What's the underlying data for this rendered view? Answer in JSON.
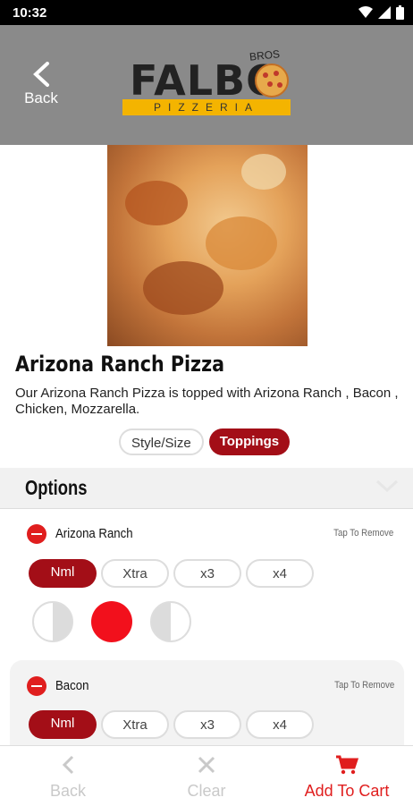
{
  "status_bar": {
    "time": "10:32"
  },
  "header": {
    "back_label": "Back",
    "logo": {
      "brand": "FALBO",
      "tag": "BROS",
      "banner": "PIZZERIA"
    }
  },
  "product": {
    "name": "Arizona Ranch Pizza",
    "description": "Our Arizona Ranch Pizza is topped with Arizona Ranch , Bacon , Chicken, Mozzarella."
  },
  "tabs": [
    {
      "label": "Style/Size",
      "active": false
    },
    {
      "label": "Toppings",
      "active": true
    }
  ],
  "options": {
    "title": "Options",
    "toppings": [
      {
        "name": "Arizona Ranch",
        "action": "Tap To Remove",
        "qty": [
          "Nml",
          "Xtra",
          "x3",
          "x4"
        ],
        "selected": "Nml",
        "coverage": "whole"
      },
      {
        "name": "Bacon",
        "action": "Tap To Remove",
        "qty": [
          "Nml",
          "Xtra",
          "x3",
          "x4"
        ],
        "selected": "Nml"
      }
    ]
  },
  "bottom_bar": {
    "back": "Back",
    "clear": "Clear",
    "add_to_cart": "Add To Cart"
  },
  "colors": {
    "brand_red": "#a30e17",
    "accent_red": "#e01e1e",
    "header_gray": "#8a8a8a",
    "logo_yellow": "#f4b400"
  }
}
